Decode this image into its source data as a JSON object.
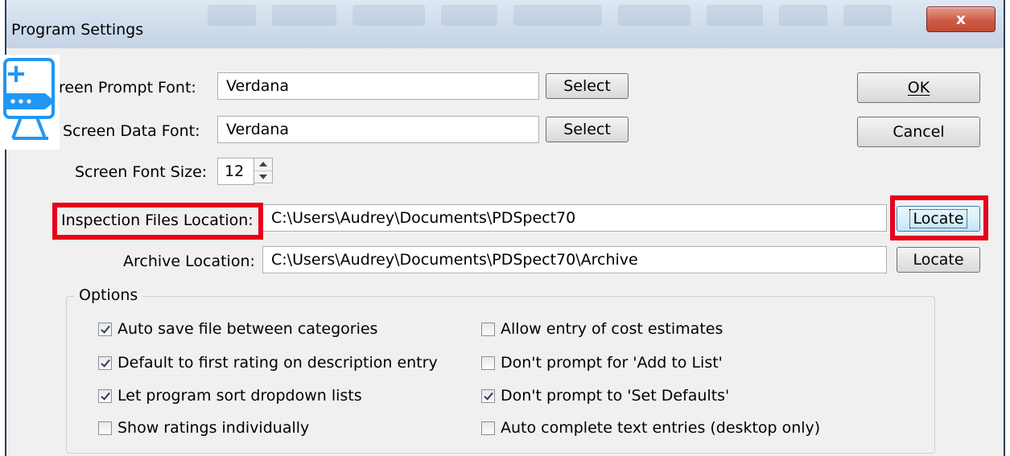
{
  "window": {
    "title": "Program Settings",
    "close_label": "x"
  },
  "buttons": {
    "ok": "OK",
    "cancel": "Cancel"
  },
  "fonts": {
    "prompt": {
      "label": "reen Prompt Font:",
      "value": "Verdana",
      "button": "Select"
    },
    "data": {
      "label": "Screen Data Font:",
      "value": "Verdana",
      "button": "Select"
    },
    "size": {
      "label": "Screen Font Size:",
      "value": "12"
    }
  },
  "locations": {
    "inspection": {
      "label": "Inspection Files Location:",
      "value": "C:\\Users\\Audrey\\Documents\\PDSpect70",
      "button": "Locate"
    },
    "archive": {
      "label": "Archive Location:",
      "value": "C:\\Users\\Audrey\\Documents\\PDSpect70\\Archive",
      "button": "Locate"
    }
  },
  "options": {
    "title": "Options",
    "left": [
      {
        "label": "Auto save file between categories",
        "checked": true
      },
      {
        "label": "Default to first rating on description entry",
        "checked": true
      },
      {
        "label": "Let program sort dropdown lists",
        "checked": true
      },
      {
        "label": "Show ratings individually",
        "checked": false
      }
    ],
    "right": [
      {
        "label": "Allow entry of cost estimates",
        "checked": false
      },
      {
        "label": "Don't prompt for 'Add to List'",
        "checked": false
      },
      {
        "label": "Don't prompt to 'Set Defaults'",
        "checked": true
      },
      {
        "label": "Auto complete text entries (desktop only)",
        "checked": false
      }
    ]
  },
  "colors": {
    "highlight": "#e8001b",
    "icon": "#2196f3"
  }
}
